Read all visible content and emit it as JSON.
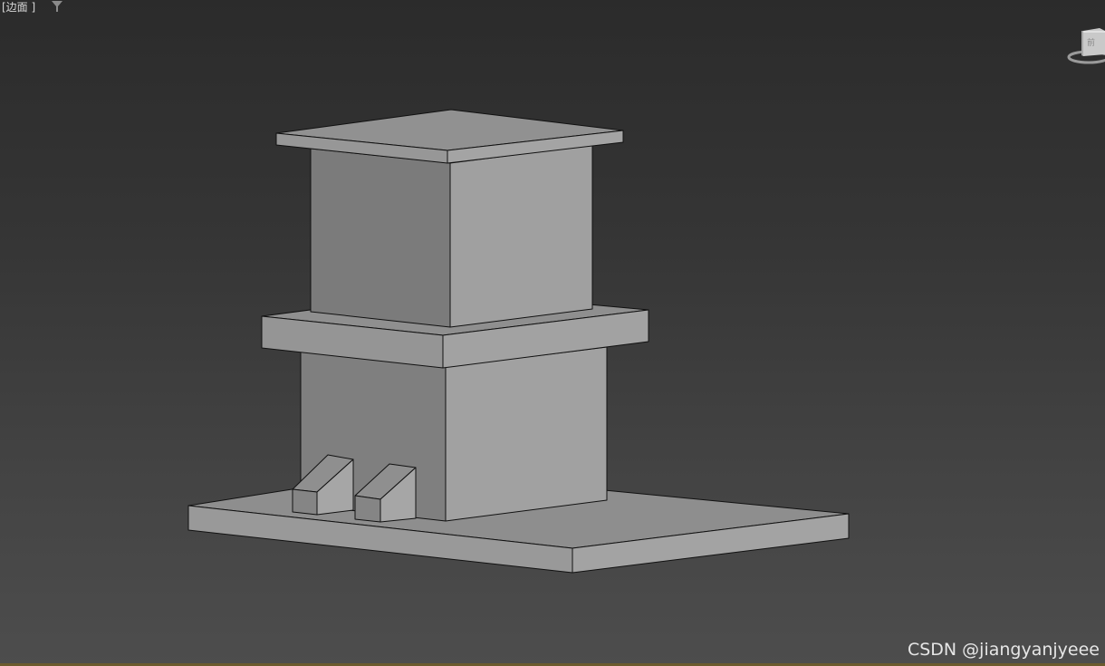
{
  "viewport": {
    "label": "[边面 ]",
    "filter_icon": "filter-funnel-icon",
    "viewcube_icon": "viewcube-icon"
  },
  "watermark": {
    "text": "CSDN @jiangyanjyeee"
  },
  "colors": {
    "background_top": "#2b2b2b",
    "background_bottom": "#4d4d4d",
    "model_light": "#a0a0a0",
    "model_mid": "#8f8f8f",
    "model_dark": "#7a7a7a",
    "edge": "#111111"
  }
}
